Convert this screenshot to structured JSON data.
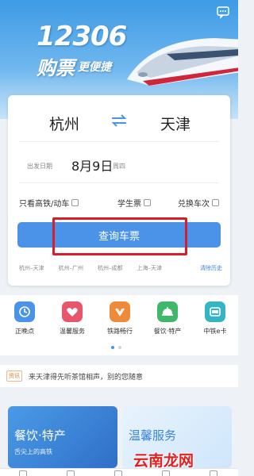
{
  "banner": {
    "brand": "12306",
    "slogan_big": "购票",
    "slogan_small": "更便捷"
  },
  "search": {
    "from_city": "杭州",
    "to_city": "天津",
    "date_label": "出发日期",
    "date_value": "8月9日",
    "weekday": "周四",
    "options": [
      {
        "label": "只看高铁/动车",
        "checked": false
      },
      {
        "label": "学生票",
        "checked": false
      },
      {
        "label": "兑换车次",
        "checked": false
      }
    ],
    "button_label": "查询车票",
    "history": [
      "杭州–天津",
      "杭州–广州",
      "杭州–成都",
      "上海–天津"
    ],
    "clear_history": "清除历史"
  },
  "services": [
    {
      "label": "正晚点",
      "icon": "clock-icon",
      "color": "#4a93e8"
    },
    {
      "label": "温馨服务",
      "icon": "heart-icon",
      "color": "#e8566b"
    },
    {
      "label": "铁路畅行",
      "icon": "rail-icon",
      "color": "#f08a3b"
    },
    {
      "label": "餐饮·特产",
      "icon": "food-bell-icon",
      "color": "#3fb86a"
    },
    {
      "label": "中铁e卡",
      "icon": "card-icon",
      "color": "#35b4c4"
    }
  ],
  "notice": {
    "tag": "资讯",
    "text": "来天津得先听茶馆相声，别的您随意"
  },
  "promos": [
    {
      "title": "餐饮·特产",
      "sub": "舌尖上的高铁"
    },
    {
      "title": "温馨服务",
      "sub": ""
    }
  ],
  "watermark": "云南龙网",
  "colors": {
    "primary": "#4a93e8",
    "highlight": "#d81e2c",
    "link": "#3a84d8"
  }
}
